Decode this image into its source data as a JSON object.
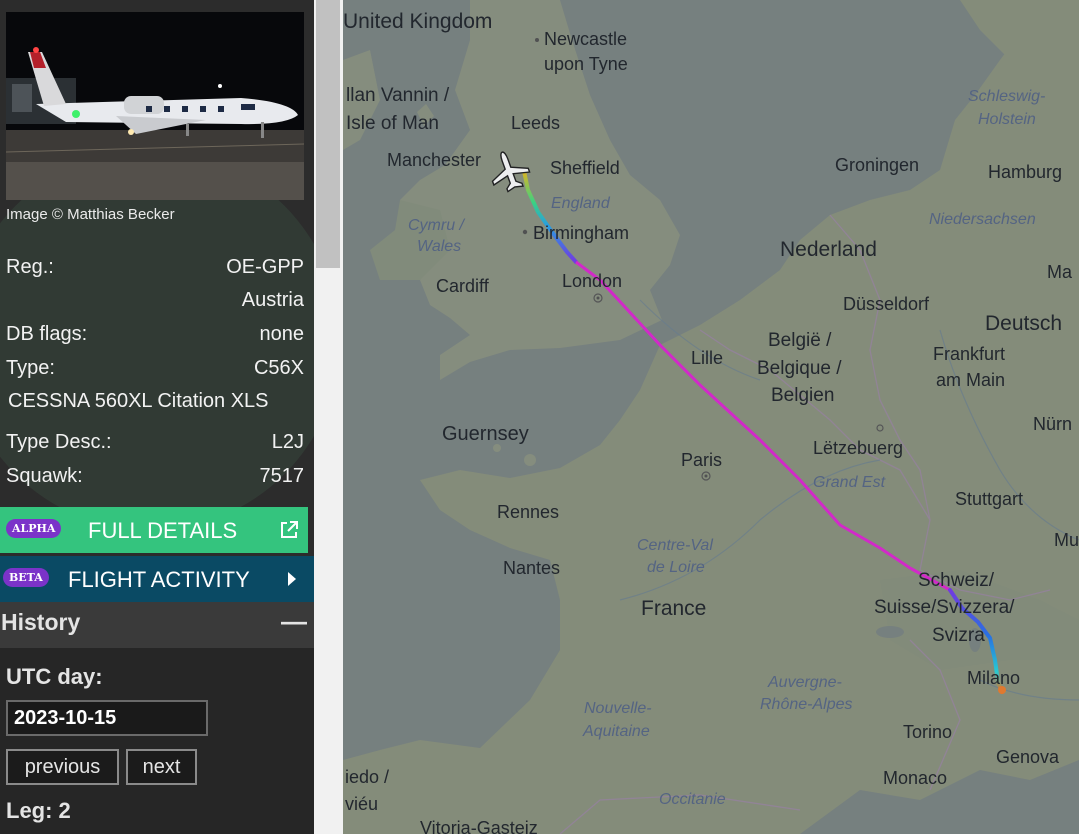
{
  "sidebar": {
    "photo_credit": "Image © Matthias Becker",
    "fields": {
      "reg_label": "Reg.:",
      "reg_value": "OE-GPP",
      "country": "Austria",
      "dbflags_label": "DB flags:",
      "dbflags_value": "none",
      "type_label": "Type:",
      "type_value": "C56X",
      "type_full": "CESSNA 560XL Citation XLS",
      "typedesc_label": "Type Desc.:",
      "typedesc_value": "L2J",
      "squawk_label": "Squawk:",
      "squawk_value": "7517"
    },
    "full_details": {
      "badge": "ALPHA",
      "label": "FULL DETAILS"
    },
    "flight_activity": {
      "badge": "BETA",
      "label": "FLIGHT ACTIVITY"
    },
    "history": {
      "title": "History",
      "collapse_symbol": "—",
      "utc_label": "UTC day:",
      "date_value": "2023-10-15",
      "prev_label": "previous",
      "next_label": "next",
      "leg_label": "Leg: 2"
    }
  },
  "map": {
    "labels": {
      "united_kingdom": "United Kingdom",
      "newcastle_1": "Newcastle",
      "newcastle_2": "upon Tyne",
      "ellan_1": "llan Vannin /",
      "ellan_2": "Isle of Man",
      "leeds": "Leeds",
      "manchester": "Manchester",
      "sheffield": "Sheffield",
      "england": "England",
      "cymru_1": "Cymru /",
      "cymru_2": "Wales",
      "birmingham": "Birmingham",
      "cardiff": "Cardiff",
      "london": "London",
      "guernsey": "Guernsey",
      "lille": "Lille",
      "belgie_1": "België /",
      "belgie_2": "Belgique /",
      "belgie_3": "Belgien",
      "nederland": "Nederland",
      "groningen": "Groningen",
      "hamburg": "Hamburg",
      "schleswig_1": "Schleswig-",
      "schleswig_2": "Holstein",
      "niedersachsen": "Niedersachsen",
      "ma": "Ma",
      "dusseldorf": "Düsseldorf",
      "deutsch": "Deutsch",
      "frankfurt_1": "Frankfurt",
      "frankfurt_2": "am Main",
      "nurn": "Nürn",
      "letzebuerg": "Lëtzebuerg",
      "grand_est": "Grand Est",
      "paris": "Paris",
      "stuttgart": "Stuttgart",
      "mu": "Mu",
      "rennes": "Rennes",
      "nantes": "Nantes",
      "centre_1": "Centre-Val",
      "centre_2": "de Loire",
      "france": "France",
      "schweiz_1": "Schweiz/",
      "schweiz_2": "Suisse/Svizzera/",
      "schweiz_3": "Svizra",
      "auvergne_1": "Auvergne-",
      "auvergne_2": "Rhône-Alpes",
      "milano": "Milano",
      "nouvelle_1": "Nouvelle-",
      "nouvelle_2": "Aquitaine",
      "torino": "Torino",
      "genova": "Genova",
      "monaco": "Monaco",
      "occitanie": "Occitanie",
      "iedo_1": "iedo /",
      "iedo_2": "viéu",
      "vitoria": "Vitoria-Gasteiz"
    },
    "colors": {
      "track_main": "#e22ad6",
      "aircraft": "#ffffff"
    }
  }
}
